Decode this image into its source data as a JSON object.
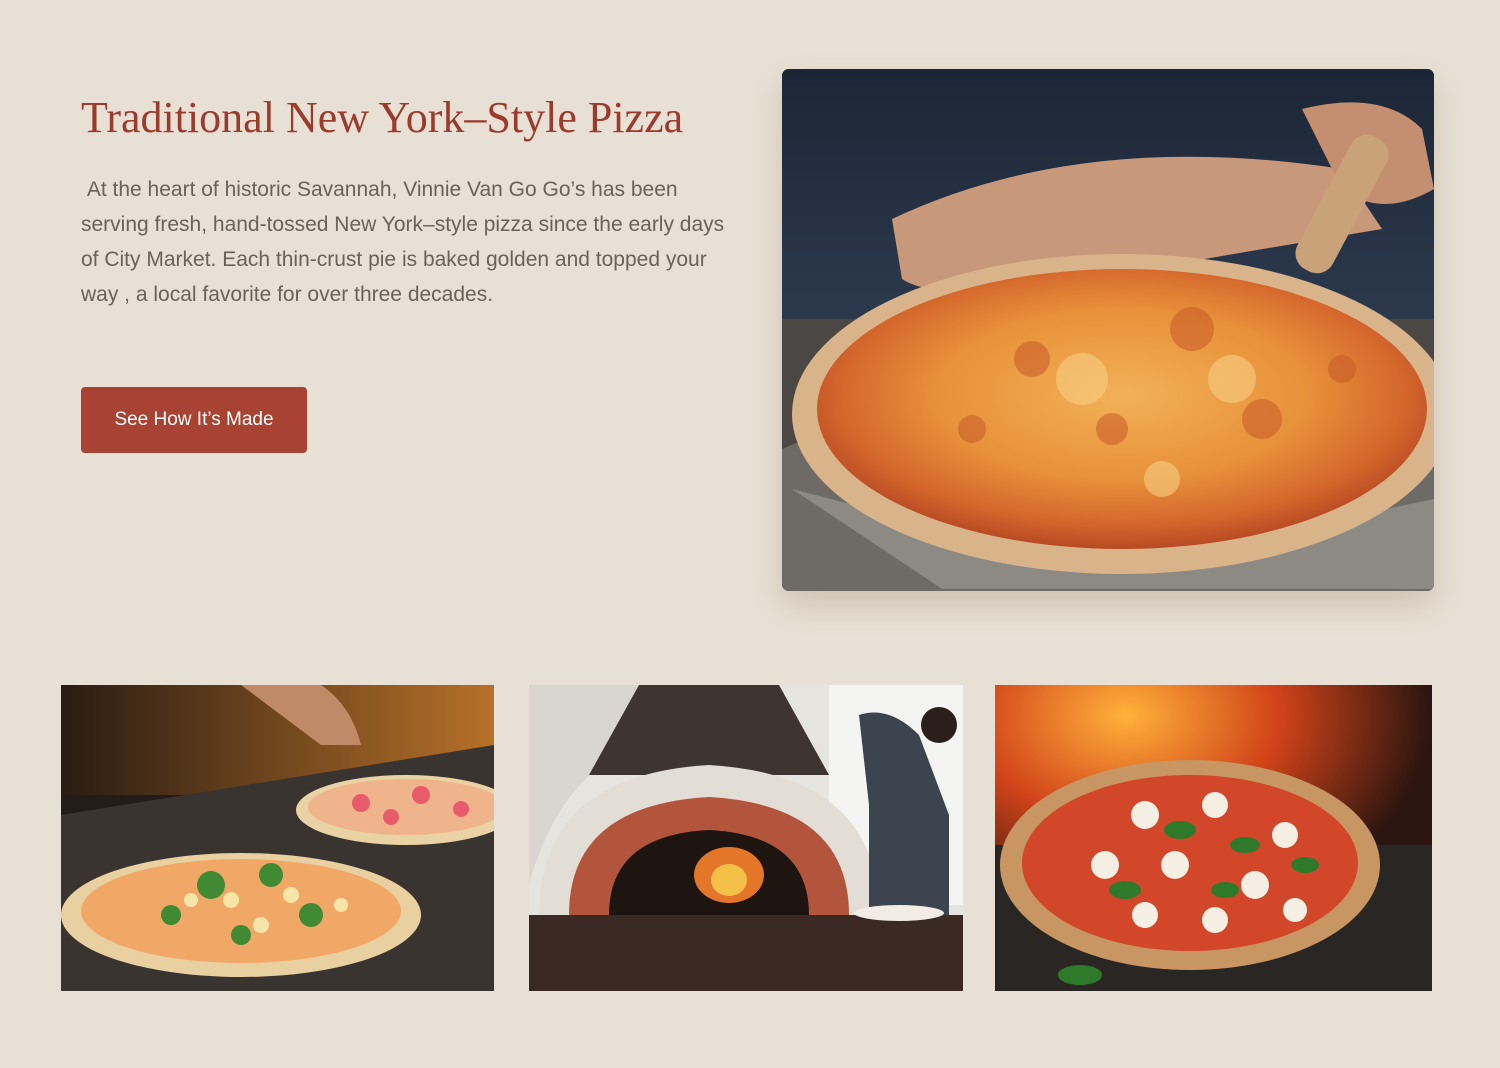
{
  "intro": {
    "title": "Traditional New York–Style Pizza",
    "description": " At the heart of historic Savannah, Vinnie Van Go Go’s has been serving fresh, hand-tossed New York–style pizza since the early days of City Market. Each thin-crust pie is baked golden and topped your way , a local favorite for over three decades.",
    "cta_label": "See How It’s Made"
  },
  "colors": {
    "background": "#e8e0d4",
    "title": "#9c3a2b",
    "body_text": "#6a615b",
    "button": "#a84232",
    "button_text": "#ffffff"
  }
}
